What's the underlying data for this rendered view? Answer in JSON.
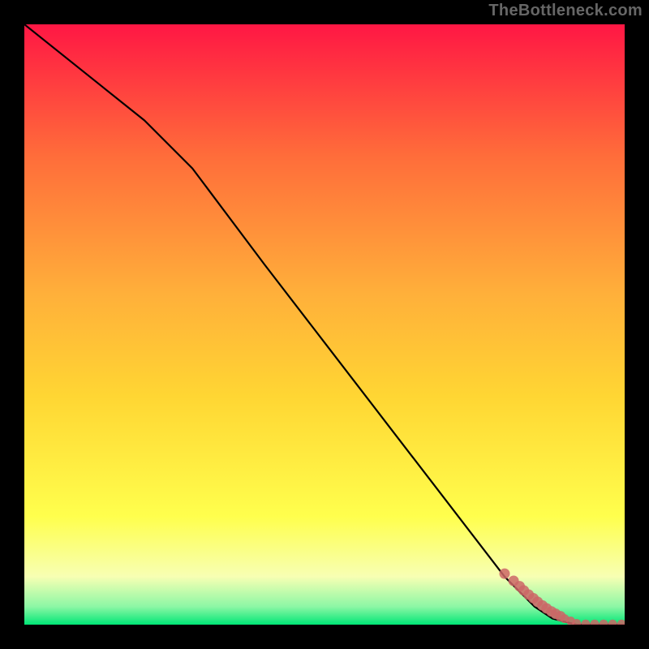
{
  "attribution": "TheBottleneck.com",
  "colors": {
    "frame": "#000000",
    "line": "#000000",
    "points": "#cc6666",
    "gradient_top": "#ff1744",
    "gradient_mid_upper": "#ff6d3a",
    "gradient_mid": "#ffd633",
    "gradient_mid_lower": "#ffff4d",
    "gradient_low": "#f7ffb3",
    "gradient_bottom": "#00e676"
  },
  "chart_data": {
    "type": "line",
    "title": "",
    "xlabel": "",
    "ylabel": "",
    "xlim": [
      0,
      100
    ],
    "ylim": [
      0,
      100
    ],
    "series": [
      {
        "name": "curve",
        "x": [
          0,
          10,
          20,
          28,
          40,
          50,
          60,
          70,
          80,
          85,
          88,
          92,
          96,
          100
        ],
        "y": [
          100,
          92,
          84,
          76,
          60,
          47,
          34,
          21,
          8,
          3,
          1,
          0,
          0,
          0
        ]
      }
    ],
    "scatter": {
      "name": "cluster",
      "x": [
        80,
        81.5,
        82.5,
        83.2,
        84,
        84.8,
        85.5,
        86.3,
        87,
        87.8,
        88.5,
        89.3,
        90,
        91,
        92,
        93.5,
        95,
        96.5,
        98,
        99.5
      ],
      "y": [
        8.5,
        7.3,
        6.4,
        5.7,
        5.0,
        4.4,
        3.8,
        3.2,
        2.7,
        2.2,
        1.8,
        1.4,
        1.0,
        0.6,
        0.2,
        0.1,
        0.1,
        0.1,
        0.1,
        0.1
      ]
    }
  }
}
